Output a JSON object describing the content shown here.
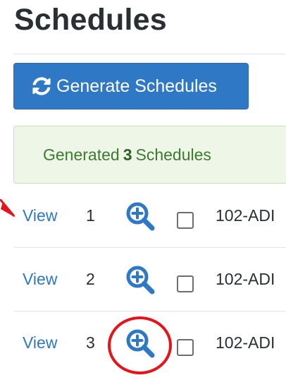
{
  "header": {
    "title": "Schedules"
  },
  "toolbar": {
    "generate_label": "Generate Schedules",
    "generate_icon": "refresh-icon"
  },
  "alert": {
    "prefix": "Generated",
    "count": "3",
    "suffix": "Schedules"
  },
  "schedules": [
    {
      "view_label": "View",
      "number": "1",
      "code": "102-ADI",
      "zoom_icon": "zoom-in-icon"
    },
    {
      "view_label": "View",
      "number": "2",
      "code": "102-ADI",
      "zoom_icon": "zoom-in-icon"
    },
    {
      "view_label": "View",
      "number": "3",
      "code": "102-ADI",
      "zoom_icon": "zoom-in-icon"
    }
  ],
  "colors": {
    "primary": "#2f78c6",
    "success_bg": "#eef7e7",
    "success_text": "#3e7a2f",
    "annotation": "#e5141b"
  }
}
